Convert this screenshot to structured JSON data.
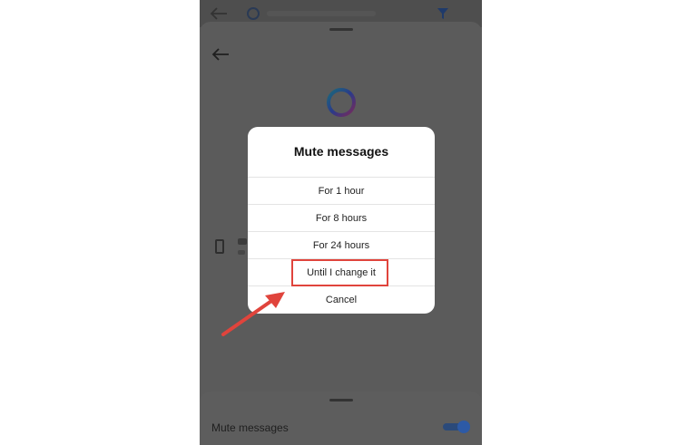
{
  "dialog": {
    "title": "Mute messages",
    "options": [
      {
        "label": "For 1 hour"
      },
      {
        "label": "For 8 hours"
      },
      {
        "label": "For 24 hours"
      },
      {
        "label": "Until I change it"
      },
      {
        "label": "Cancel"
      }
    ]
  },
  "bottom_sheet": {
    "mute_label": "Mute messages",
    "mute_toggle_on": true
  },
  "colors": {
    "annotation": "#e0443c",
    "toggle_accent": "#2d5aa6"
  },
  "icons": [
    "back-arrow-icon",
    "ring-logo-icon",
    "phone-icon",
    "filter-icon"
  ]
}
